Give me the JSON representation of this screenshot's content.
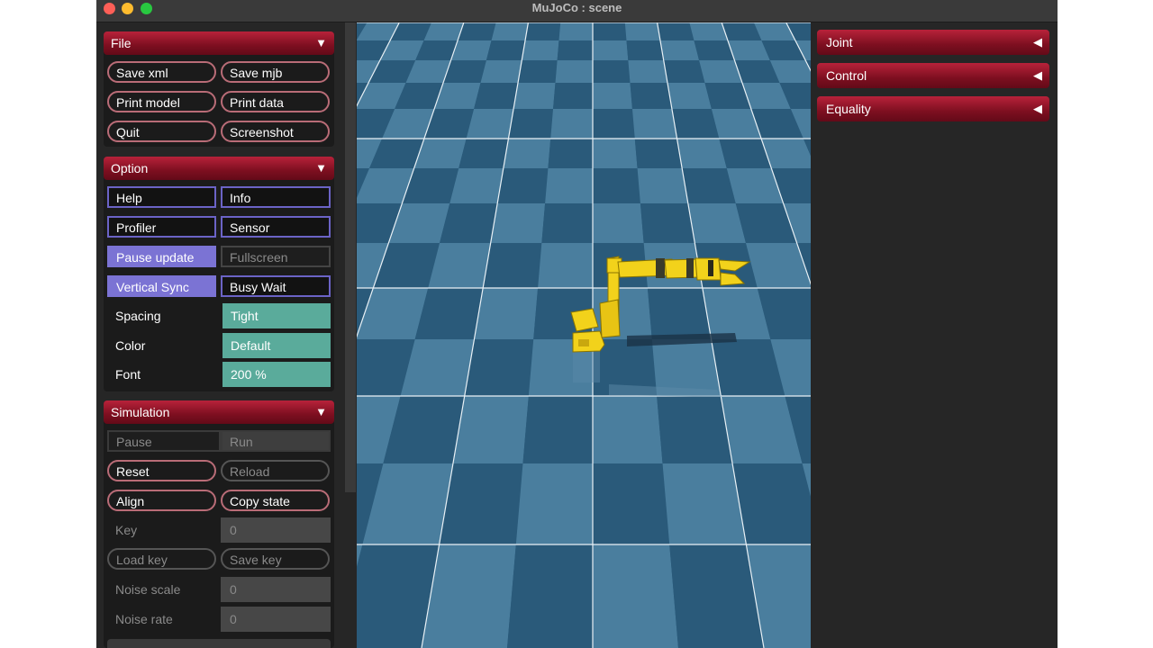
{
  "window": {
    "title": "MuJoCo : scene"
  },
  "file": {
    "header": "File",
    "save_xml": "Save xml",
    "save_mjb": "Save mjb",
    "print_model": "Print model",
    "print_data": "Print data",
    "quit": "Quit",
    "screenshot": "Screenshot"
  },
  "option": {
    "header": "Option",
    "help": "Help",
    "info": "Info",
    "profiler": "Profiler",
    "sensor": "Sensor",
    "pause_update": "Pause update",
    "fullscreen": "Fullscreen",
    "vertical_sync": "Vertical Sync",
    "busy_wait": "Busy Wait",
    "spacing_label": "Spacing",
    "spacing_value": "Tight",
    "color_label": "Color",
    "color_value": "Default",
    "font_label": "Font",
    "font_value": "200 %"
  },
  "simulation": {
    "header": "Simulation",
    "pause": "Pause",
    "run": "Run",
    "reset": "Reset",
    "reload": "Reload",
    "align": "Align",
    "copy_state": "Copy state",
    "key_label": "Key",
    "key_value": "0",
    "load_key": "Load key",
    "save_key": "Save key",
    "noise_scale_label": "Noise scale",
    "noise_scale_value": "0",
    "noise_rate_label": "Noise rate",
    "noise_rate_value": "0"
  },
  "right": {
    "joint": "Joint",
    "control": "Control",
    "equality": "Equality"
  },
  "colors": {
    "header_red": "#b8223a",
    "toggle_on": "#7b73d4",
    "select_teal": "#5aab9b",
    "floor_dark": "#2a5a7a",
    "floor_light": "#4a7e9e",
    "robot_yellow": "#f2d21b"
  }
}
